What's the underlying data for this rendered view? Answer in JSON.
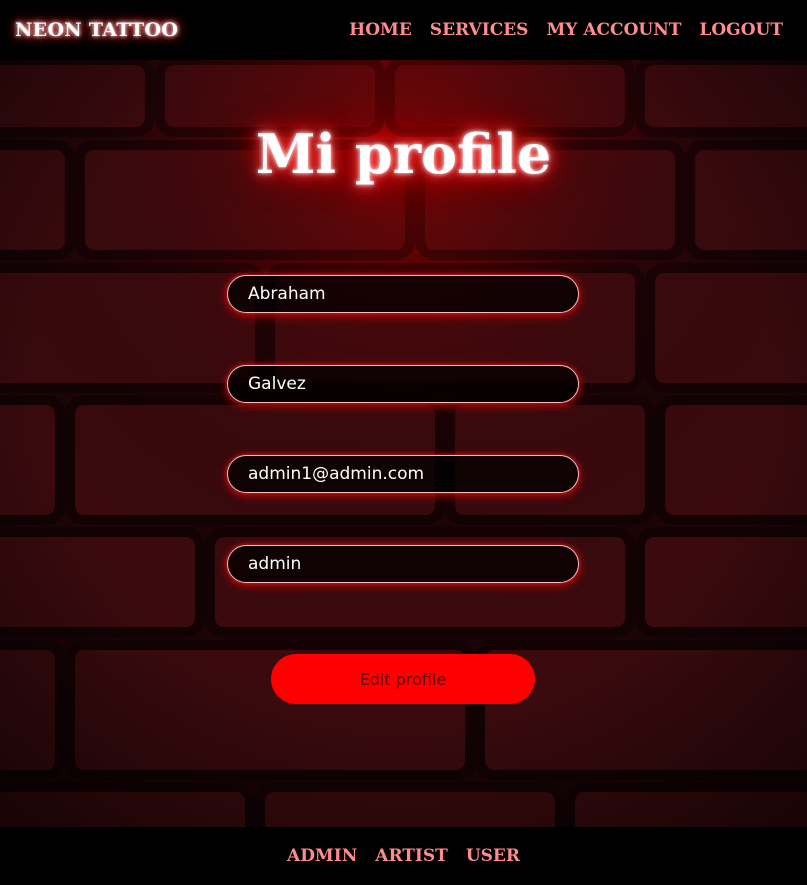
{
  "navbar": {
    "brand": "NEON TATTOO",
    "links": [
      "HOME",
      "SERVICES",
      "MY ACCOUNT",
      "LOGOUT"
    ]
  },
  "profile": {
    "title": "Mi profile",
    "fields": {
      "first_name": "Abraham",
      "last_name": "Galvez",
      "email": "admin1@admin.com",
      "role": "admin"
    },
    "edit_button": "Edit profile"
  },
  "footer": {
    "links": [
      "ADMIN",
      "ARTIST",
      "USER"
    ]
  },
  "colors": {
    "accent": "#ff0000",
    "nav_link": "#ff8c8c",
    "background": "#1a0406"
  }
}
